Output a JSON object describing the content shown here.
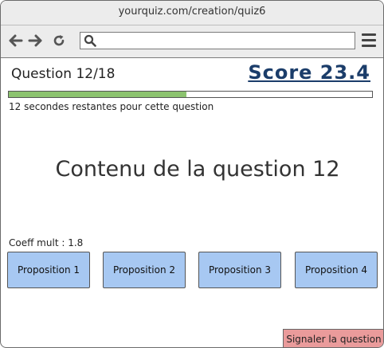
{
  "browser": {
    "url": "yourquiz.com/creation/quiz6",
    "search_value": ""
  },
  "quiz": {
    "question_label": "Question 12/18",
    "score": "Score 23.4",
    "progress_fraction": 0.49,
    "timer_text": "12 secondes restantes pour cette question",
    "question_content": "Contenu de la question 12",
    "coeff_text": "Coeff mult : 1.8",
    "propositions": [
      "Proposition 1",
      "Proposition 2",
      "Proposition 3",
      "Proposition 4"
    ],
    "report_label": "Signaler la question"
  },
  "colors": {
    "progress_fill": "#8cc36f",
    "score_text": "#1b3d6a",
    "proposition_bg": "#a7c8f2",
    "report_bg": "#ea9b9b"
  },
  "icons": {
    "back": "arrow-left-icon",
    "forward": "arrow-right-icon",
    "reload": "reload-icon",
    "search": "search-icon",
    "menu": "hamburger-menu-icon"
  }
}
